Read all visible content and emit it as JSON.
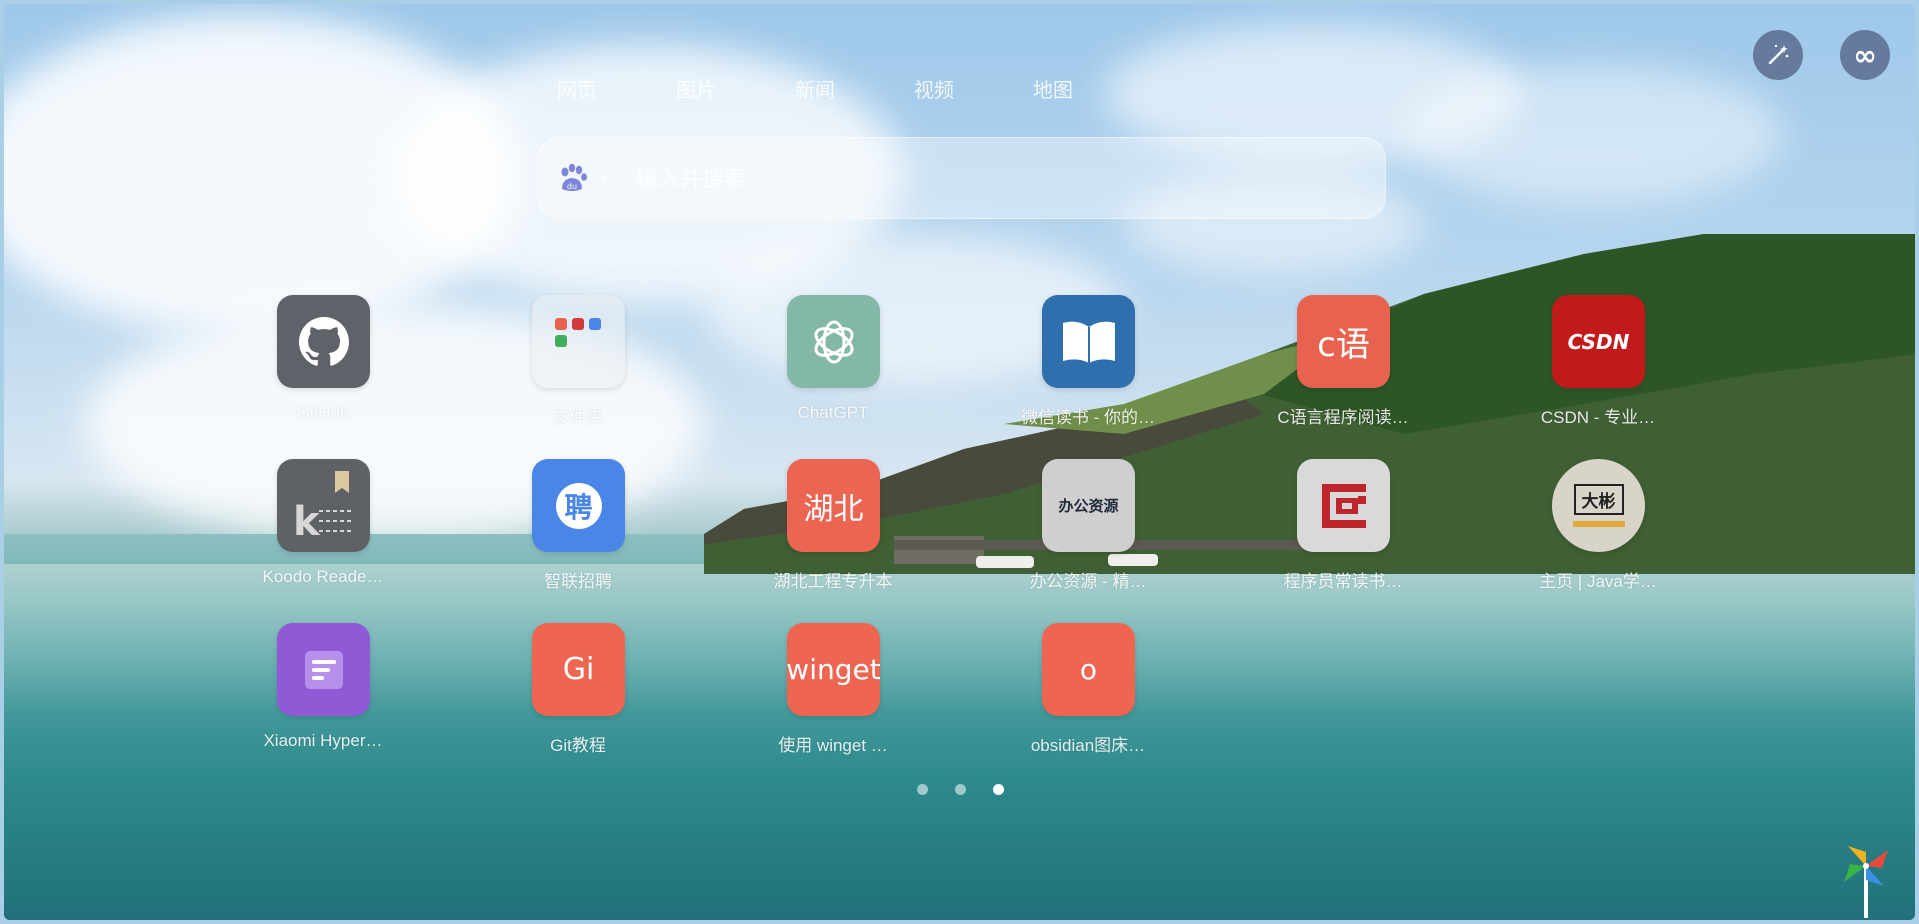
{
  "tabs": [
    "网页",
    "图片",
    "新闻",
    "视频",
    "地图"
  ],
  "search": {
    "placeholder": "输入并搜索",
    "engine_icon": "baidu-paw-icon"
  },
  "top_buttons": {
    "left_icon": "magic-wand-icon",
    "right_icon": "infinity-icon",
    "right_glyph": "∞"
  },
  "apps": [
    {
      "label": "GitHub",
      "icon": "github-icon",
      "color": "#5f6369"
    },
    {
      "label": "文件夹",
      "icon": "folder-icon",
      "color": "#e9edf1"
    },
    {
      "label": "ChatGPT",
      "icon": "openai-icon",
      "color": "#83b7a8"
    },
    {
      "label": "微信读书 - 你的…",
      "icon": "book-icon",
      "color": "#2f6fae"
    },
    {
      "label": "C语言程序阅读…",
      "icon": "text-icon",
      "text": "c语",
      "color": "#e7624f"
    },
    {
      "label": "CSDN - 专业…",
      "icon": "csdn-icon",
      "text": "CSDN",
      "color": "#c21a1a"
    },
    {
      "label": "Koodo Reade…",
      "icon": "koodo-icon",
      "color": "#5e6166"
    },
    {
      "label": "智联招聘",
      "icon": "zhilian-icon",
      "text": "聘",
      "color": "#4a86e8"
    },
    {
      "label": "湖北工程专升本",
      "icon": "text-icon",
      "text": "湖北",
      "color": "#ec6552"
    },
    {
      "label": "办公资源 - 精…",
      "icon": "office-resource-icon",
      "text": "办公资源",
      "color": "#cfcfcf"
    },
    {
      "label": "程序员常读书…",
      "icon": "reader-icon",
      "color": "#d9d9d9"
    },
    {
      "label": "主页 | Java学…",
      "icon": "dabin-icon",
      "text": "大彬",
      "color": "#d9d4c8"
    },
    {
      "label": "Xiaomi Hyper…",
      "icon": "notes-icon",
      "color": "#9059d6"
    },
    {
      "label": "Git教程",
      "icon": "text-icon",
      "text": "Gi",
      "color": "#ee6552"
    },
    {
      "label": "使用 winget …",
      "icon": "text-icon",
      "text": "winget",
      "color": "#ee6552"
    },
    {
      "label": "obsidian图床…",
      "icon": "text-icon",
      "text": "o",
      "color": "#ee6552"
    }
  ],
  "pager": {
    "pages": 3,
    "active": 3
  },
  "corner_icon": "pinwheel-icon"
}
